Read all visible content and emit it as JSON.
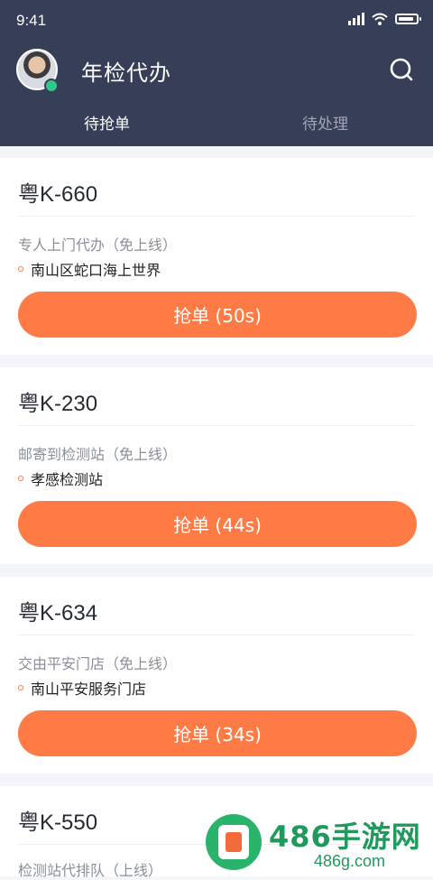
{
  "status_bar": {
    "time": "9:41"
  },
  "header": {
    "title": "年检代办"
  },
  "tabs": [
    {
      "label": "待抢单",
      "active": true
    },
    {
      "label": "待处理",
      "active": false
    }
  ],
  "orders": [
    {
      "plate": "粤K-660",
      "service": "专人上门代办（免上线）",
      "location": "南山区蛇口海上世界",
      "button": "抢单 (50s)"
    },
    {
      "plate": "粤K-230",
      "service": "邮寄到检测站（免上线）",
      "location": "孝感检测站",
      "button": "抢单 (44s)"
    },
    {
      "plate": "粤K-634",
      "service": "交由平安门店（免上线）",
      "location": "南山平安服务门店",
      "button": "抢单 (34s)"
    },
    {
      "plate": "粤K-550",
      "service": "检测站代排队（上线）"
    }
  ],
  "watermark": {
    "name": "486手游网",
    "site": "486g.com"
  },
  "colors": {
    "header_bg": "#363f57",
    "accent": "#ff7b46",
    "page_bg": "#f4f5f8"
  }
}
